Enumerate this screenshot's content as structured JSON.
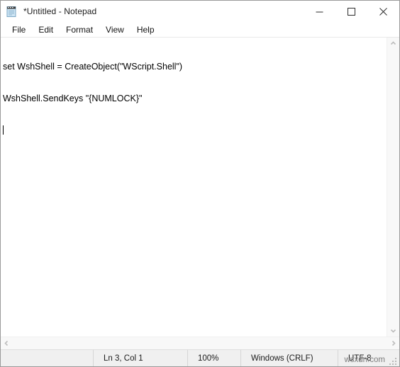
{
  "window": {
    "title": "*Untitled - Notepad",
    "icon": "notepad-icon",
    "controls": {
      "minimize": "minimize-icon",
      "maximize": "maximize-icon",
      "close": "close-icon"
    }
  },
  "menubar": {
    "items": [
      {
        "label": "File"
      },
      {
        "label": "Edit"
      },
      {
        "label": "Format"
      },
      {
        "label": "View"
      },
      {
        "label": "Help"
      }
    ]
  },
  "editor": {
    "lines": [
      "set WshShell = CreateObject(\"WScript.Shell\")",
      "WshShell.SendKeys \"{NUMLOCK}\"",
      ""
    ],
    "caret_line": 3
  },
  "scrollbars": {
    "vertical": {
      "up": "chevron-up-icon",
      "down": "chevron-down-icon"
    },
    "horizontal": {
      "left": "chevron-left-icon",
      "right": "chevron-right-icon"
    }
  },
  "statusbar": {
    "position": "Ln 3, Col 1",
    "zoom": "100%",
    "line_ending": "Windows (CRLF)",
    "encoding": "UTF-8",
    "watermark": "wsxdn.com"
  },
  "colors": {
    "window_border": "#9a9a9a",
    "statusbar_bg": "#f0f0f0",
    "scrollbar_bg": "#f8f8f8",
    "text": "#000000",
    "watermark": "#7d7d7d"
  }
}
